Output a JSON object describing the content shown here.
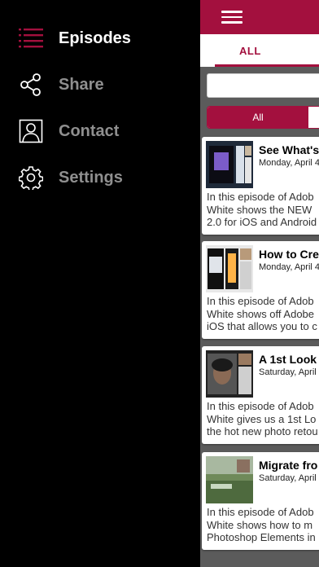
{
  "menu": {
    "items": [
      {
        "label": "Episodes",
        "icon": "list-icon",
        "active": true
      },
      {
        "label": "Share",
        "icon": "share-icon",
        "active": false
      },
      {
        "label": "Contact",
        "icon": "contact-icon",
        "active": false
      },
      {
        "label": "Settings",
        "icon": "gear-icon",
        "active": false
      }
    ]
  },
  "header": {
    "menu_icon": "hamburger-icon"
  },
  "tabs": {
    "active_label": "ALL"
  },
  "search": {
    "placeholder": ""
  },
  "filter": {
    "selected": "All"
  },
  "episodes": [
    {
      "title": "See What's",
      "date": "Monday, April 4",
      "desc": [
        "In this episode of Adob",
        "White shows the NEW",
        "2.0 for iOS and Android"
      ]
    },
    {
      "title": "How to Cre",
      "date": "Monday, April 4",
      "desc": [
        "In this episode of Adob",
        "White shows off Adobe",
        "iOS that allows you to c"
      ]
    },
    {
      "title": "A 1st Look",
      "date": "Saturday, April",
      "desc": [
        "In this episode of Adob",
        "White gives us a 1st Lo",
        "the hot new photo retou"
      ]
    },
    {
      "title": "Migrate fro",
      "date": "Saturday, April",
      "desc": [
        "In this episode of Adob",
        "White shows how to m",
        "Photoshop Elements in"
      ]
    }
  ],
  "colors": {
    "accent": "#a3103e",
    "inactive_menu": "#8f8f8f"
  }
}
